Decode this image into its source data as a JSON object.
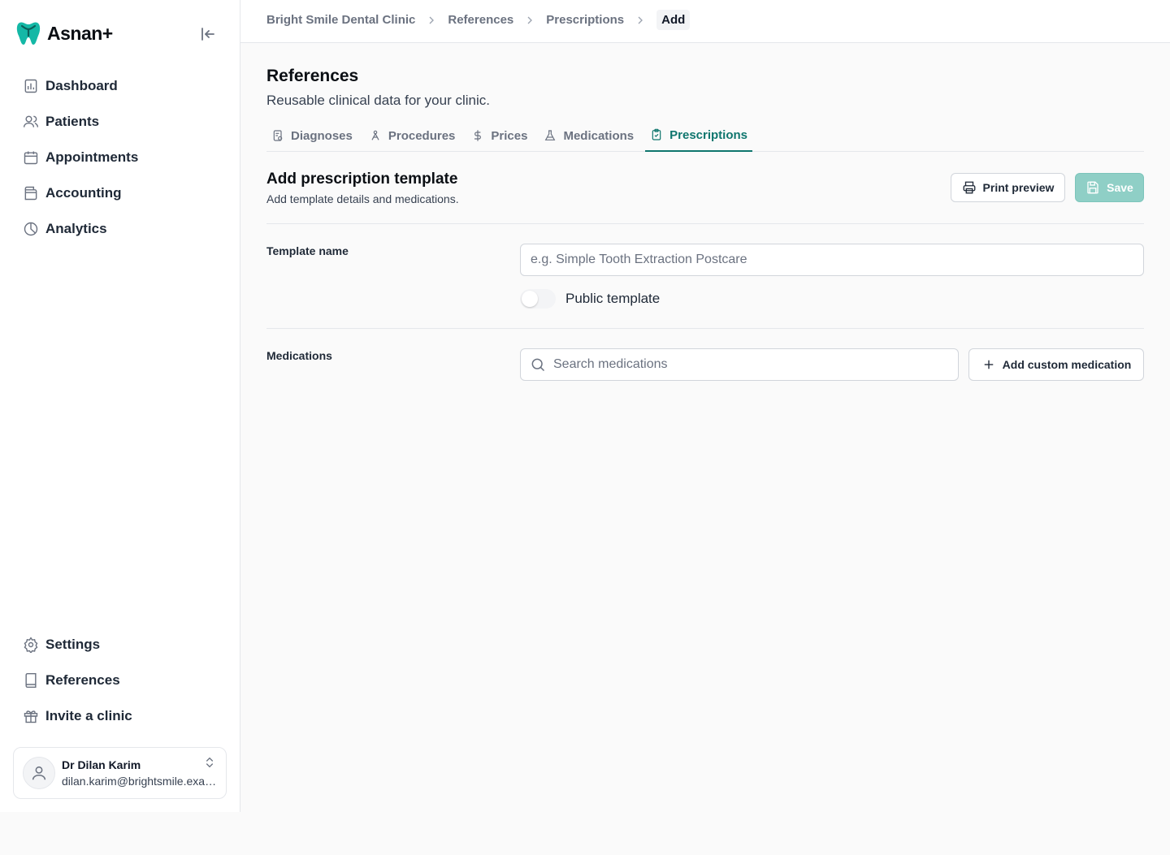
{
  "app": {
    "name": "Asnan+"
  },
  "colors": {
    "accent": "#0f766e",
    "save_bg": "#8fcfc6"
  },
  "sidebar": {
    "top_items": [
      {
        "label": "Dashboard",
        "icon": "chart-icon"
      },
      {
        "label": "Patients",
        "icon": "users-icon"
      },
      {
        "label": "Appointments",
        "icon": "calendar-icon"
      },
      {
        "label": "Accounting",
        "icon": "wallet-icon"
      },
      {
        "label": "Analytics",
        "icon": "pie-chart-icon"
      }
    ],
    "bottom_items": [
      {
        "label": "Settings",
        "icon": "gear-icon"
      },
      {
        "label": "References",
        "icon": "book-icon"
      },
      {
        "label": "Invite a clinic",
        "icon": "gift-icon"
      }
    ],
    "user": {
      "name": "Dr Dilan Karim",
      "email": "dilan.karim@brightsmile.example"
    }
  },
  "breadcrumb": [
    "Bright Smile Dental Clinic",
    "References",
    "Prescriptions",
    "Add"
  ],
  "page": {
    "title": "References",
    "subtitle": "Reusable clinical data for your clinic."
  },
  "tabs": [
    {
      "label": "Diagnoses",
      "icon": "clipboard-icon"
    },
    {
      "label": "Procedures",
      "icon": "procedure-icon"
    },
    {
      "label": "Prices",
      "icon": "dollar-icon"
    },
    {
      "label": "Medications",
      "icon": "flask-icon"
    },
    {
      "label": "Prescriptions",
      "icon": "clipboard-check-icon",
      "active": true
    }
  ],
  "form": {
    "title": "Add prescription template",
    "subtitle": "Add template details and medications.",
    "print_preview_label": "Print preview",
    "save_label": "Save",
    "template_name_label": "Template name",
    "template_name_placeholder": "e.g. Simple Tooth Extraction Postcare",
    "template_name_value": "",
    "public_toggle_label": "Public template",
    "public_toggle_on": false,
    "medications_label": "Medications",
    "medication_search_placeholder": "Search medications",
    "add_custom_label": "Add custom medication"
  }
}
